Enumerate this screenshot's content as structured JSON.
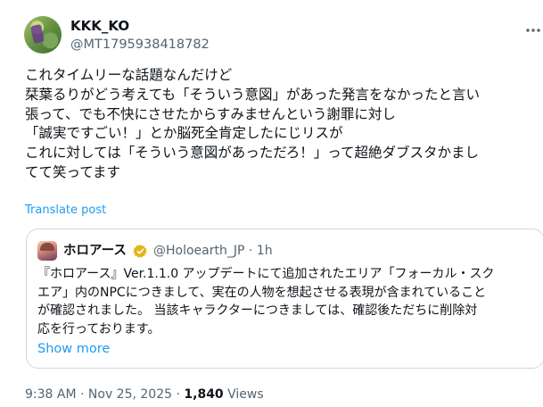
{
  "author": {
    "display_name": "KKK_KO",
    "handle": "@MT1795938418782"
  },
  "post": {
    "lines": [
      "これタイムリーな話題なんだけど",
      "栞葉るりがどう考えても「そういう意図」があった発言をなかったと言い",
      "張って、でも不快にさせたからすみませんという謝罪に対し",
      "「誠実ですごい！」とか脳死全肯定したにじリスが",
      "これに対しては「そういう意図があっただろ！」って超絶ダブスタかまし",
      "てて笑ってます"
    ],
    "translate_label": "Translate post"
  },
  "quote": {
    "display_name": "ホロアース",
    "verified_icon": "gold-verified-badge",
    "handle": "@Holoearth_JP",
    "separator": "·",
    "time": "1h",
    "lines": [
      "『ホロアース』Ver.1.1.0 アップデートにて追加されたエリア「フォーカル・スク",
      "エア」内のNPCにつきまして、実在の人物を想起させる表現が含まれていること",
      "が確認されました。 当該キャラクターにつきましては、確認後ただちに削除対",
      "応を行っております。"
    ],
    "show_more_label": "Show more"
  },
  "meta": {
    "time": "9:38 AM",
    "separator": "·",
    "date": "Nov 25, 2025",
    "views_count": "1,840",
    "views_label": "Views"
  },
  "colors": {
    "link": "#1d9bf0",
    "secondary_text": "#536471",
    "primary_text": "#0f1419",
    "border": "#cfd9de",
    "verified_gold": "#e2b719"
  }
}
